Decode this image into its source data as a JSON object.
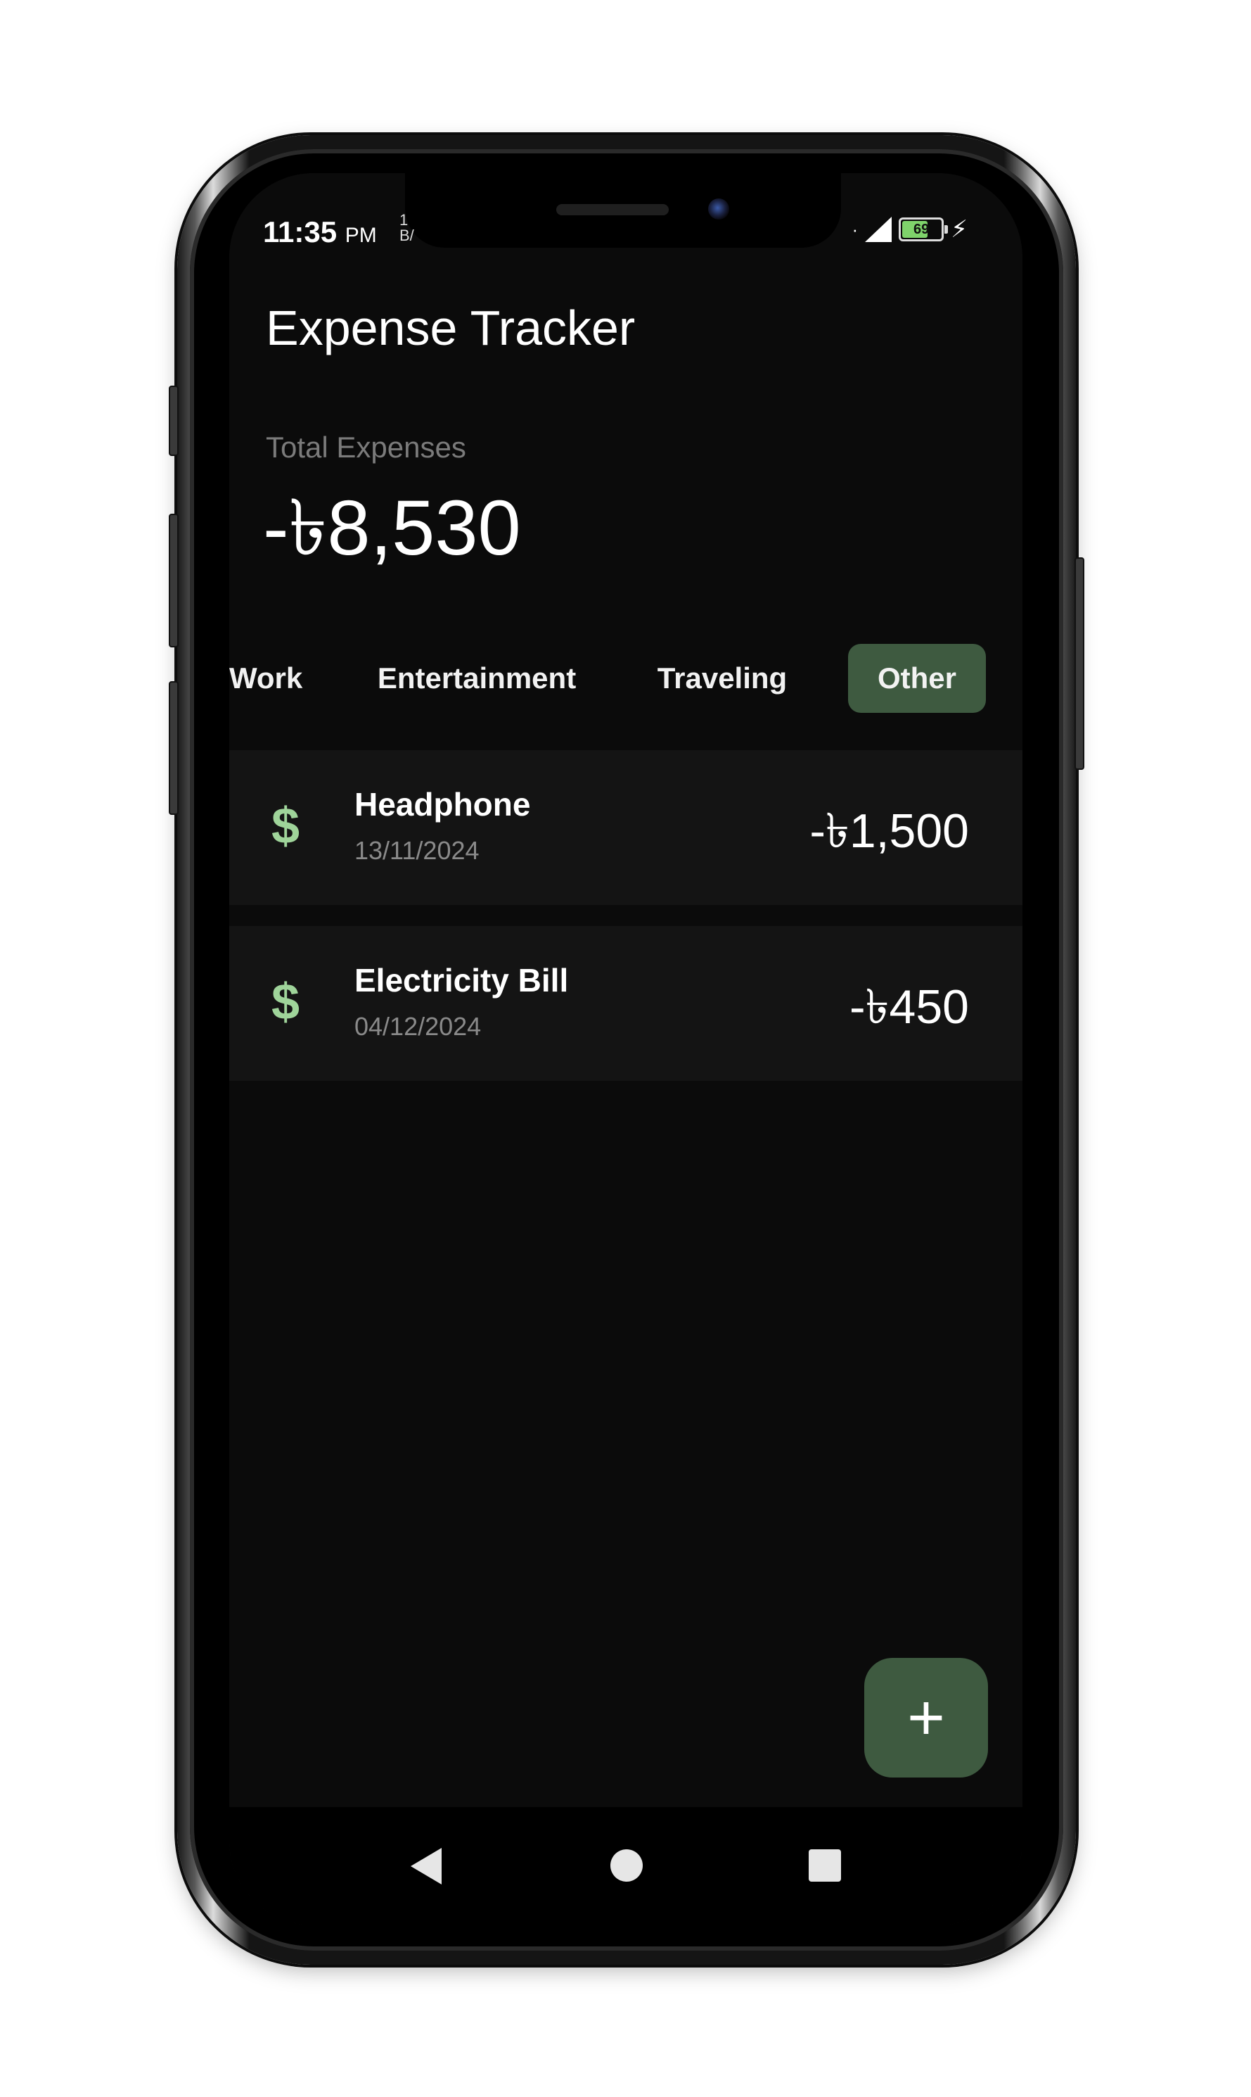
{
  "status_bar": {
    "time": "11:35",
    "ampm": "PM",
    "mini_line1": "1",
    "mini_line2": "B/",
    "battery": "69",
    "battery_level": 0.69
  },
  "header": {
    "title": "Expense Tracker"
  },
  "summary": {
    "label": "Total Expenses",
    "value": "-৳8,530"
  },
  "tabs": [
    {
      "label": "Work",
      "active": false
    },
    {
      "label": "Entertainment",
      "active": false
    },
    {
      "label": "Traveling",
      "active": false
    },
    {
      "label": "Other",
      "active": true
    }
  ],
  "expenses": [
    {
      "icon": "$",
      "name": "Headphone",
      "date": "13/11/2024",
      "amount": "-৳1,500"
    },
    {
      "icon": "$",
      "name": "Electricity Bill",
      "date": "04/12/2024",
      "amount": "-৳450"
    }
  ],
  "fab": {
    "label": "+"
  },
  "colors": {
    "background": "#0b0b0b",
    "card": "#141414",
    "accent": "#3e5a40",
    "icon_green": "#9fd49a"
  }
}
